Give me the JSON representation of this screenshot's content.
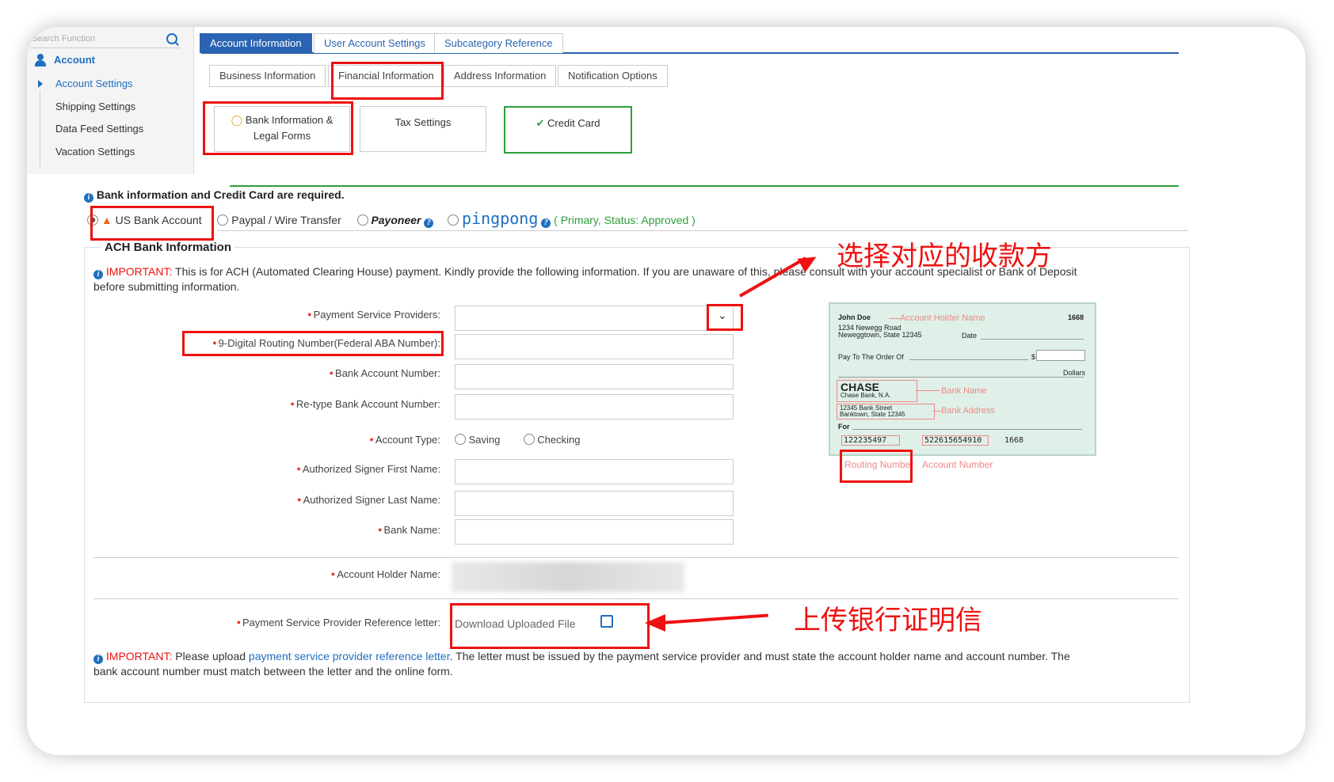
{
  "sidebar": {
    "search_placeholder": "Search Function",
    "account_label": "Account",
    "items": [
      {
        "label": "Account Settings"
      },
      {
        "label": "Shipping Settings"
      },
      {
        "label": "Data Feed Settings"
      },
      {
        "label": "Vacation Settings"
      }
    ]
  },
  "top_tabs": [
    "Account Information",
    "User Account Settings",
    "Subcategory Reference"
  ],
  "sub_tabs": [
    "Business Information",
    "Financial Information",
    "Address Information",
    "Notification Options"
  ],
  "cards": {
    "bank_line1": "Bank Information &",
    "bank_line2": "Legal Forms",
    "tax": "Tax Settings",
    "credit": "Credit Card"
  },
  "notice_required": "Bank information and Credit Card are required.",
  "payment_options": {
    "us_bank": "US Bank Account",
    "paypal": "Paypal / Wire Transfer",
    "payoneer": "Payoneer",
    "pingpong": "pingpong",
    "primary_status": "( Primary, Status: Approved )"
  },
  "ach": {
    "legend": "ACH Bank Information",
    "important_label": "IMPORTANT:",
    "important_text1": "This is for ACH (Automated Clearing House) payment. Kindly provide the following information. If you are unaware of this, please consult with your account specialist or Bank of Deposit",
    "important_text2": "before submitting information."
  },
  "fields": {
    "psp": "Payment Service Providers:",
    "routing": "9-Digital Routing Number(Federal ABA Number):",
    "acct_num": "Bank Account Number:",
    "retype": "Re-type Bank Account Number:",
    "acct_type": "Account Type:",
    "saving": "Saving",
    "checking": "Checking",
    "first_name": "Authorized Signer First Name:",
    "last_name": "Authorized Signer Last Name:",
    "bank_name": "Bank Name:",
    "holder": "Account Holder Name:",
    "ref_letter": "Payment Service Provider Reference letter:",
    "download": "Download Uploaded File"
  },
  "bottom_notice": {
    "label": "IMPORTANT:",
    "text1": "Please upload",
    "link": "payment service provider reference letter",
    "text2": ". The letter must be issued by the payment service provider and must state the account holder name and account number. The",
    "text3": "bank account number must match between the letter and the online form."
  },
  "check": {
    "name": "John Doe",
    "holder_label": "Account Holder Name",
    "number": "1668",
    "addr1": "1234 Newegg Road",
    "addr2": "Neweggtown, State 12345",
    "date": "Date",
    "pay_to": "Pay To The Order Of",
    "dollar_sign": "$",
    "dollars": "Dollars",
    "bank": "CHASE",
    "bank_sub": "Chase Bank, N.A.",
    "bank_name_label": "Bank Name",
    "bank_addr1": "12345 Bank Street",
    "bank_addr2": "Banktown, State 12345",
    "bank_addr_label": "Bank Address",
    "for": "For",
    "micr_routing": "122235497",
    "micr_account": "522615654910",
    "micr_check": "1668",
    "routing_label": "Routing Number",
    "account_label": "Account Number"
  },
  "annotations": {
    "choose": "选择对应的收款方",
    "upload": "上传银行证明信"
  },
  "colors": {
    "accent": "#2a64b2",
    "highlight": "#ee1111",
    "success": "#2e9e3c"
  }
}
